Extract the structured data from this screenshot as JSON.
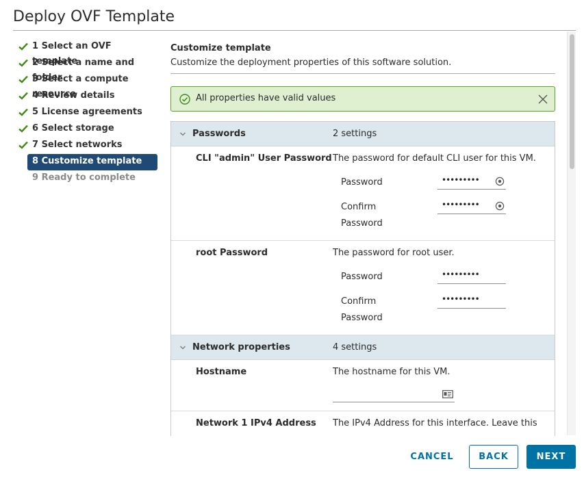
{
  "window": {
    "title": "Deploy OVF Template"
  },
  "steps": [
    {
      "label": "1 Select an OVF template",
      "state": "done"
    },
    {
      "label": "2 Select a name and folder",
      "state": "done"
    },
    {
      "label": "3 Select a compute resource",
      "state": "done"
    },
    {
      "label": "4 Review details",
      "state": "done"
    },
    {
      "label": "5 License agreements",
      "state": "done"
    },
    {
      "label": "6 Select storage",
      "state": "done"
    },
    {
      "label": "7 Select networks",
      "state": "done"
    },
    {
      "label": "8 Customize template",
      "state": "active"
    },
    {
      "label": "9 Ready to complete",
      "state": "pending"
    }
  ],
  "section": {
    "title": "Customize template",
    "description": "Customize the deployment properties of this software solution."
  },
  "alert": {
    "text": "All properties have valid values",
    "icon": "check-circle-icon"
  },
  "groups": {
    "passwords": {
      "name": "Passwords",
      "count": "2 settings"
    },
    "network": {
      "name": "Network properties",
      "count": "4 settings"
    }
  },
  "properties": {
    "cli_admin": {
      "name": "CLI \"admin\" User Password",
      "description": "The password for default CLI user for this VM.",
      "password_label": "Password",
      "confirm_label_1": "Confirm",
      "confirm_label_2": "Password",
      "password_value": "•••••••••",
      "confirm_value": "•••••••••"
    },
    "root": {
      "name": "root Password",
      "description": "The password for root user.",
      "password_label": "Password",
      "confirm_label_1": "Confirm",
      "confirm_label_2": "Password",
      "password_value": "•••••••••",
      "confirm_value": "•••••••••"
    },
    "hostname": {
      "name": "Hostname",
      "description": "The hostname for this VM.",
      "value": ""
    },
    "ipv4": {
      "name": "Network 1 IPv4 Address",
      "description": "The IPv4 Address for this interface. Leave this"
    }
  },
  "buttons": {
    "cancel": "CANCEL",
    "back": "BACK",
    "next": "NEXT"
  },
  "colors": {
    "accent": "#0072a3",
    "active_step": "#1f4a75",
    "success": "#5aa220",
    "group_header": "#dde7ee"
  }
}
